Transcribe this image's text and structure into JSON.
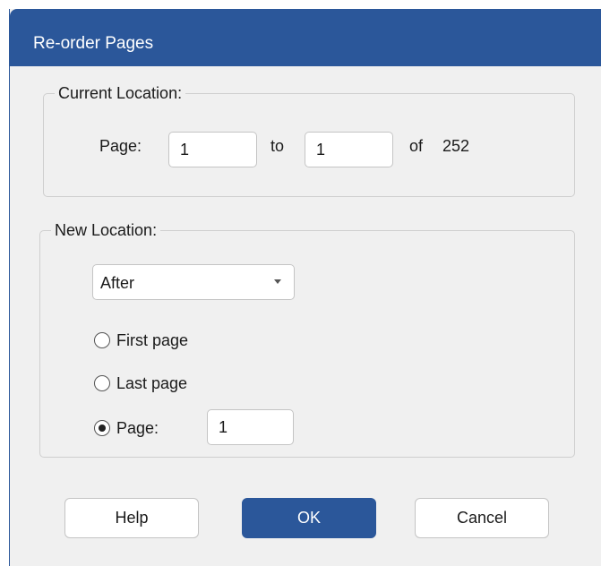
{
  "dialog": {
    "title": "Re-order Pages"
  },
  "current_location": {
    "legend": "Current Location:",
    "page_label": "Page:",
    "from_value": "1",
    "to_label": "to",
    "to_value": "1",
    "of_label": "of",
    "total_pages": "252"
  },
  "new_location": {
    "legend": "New Location:",
    "position_select": "After",
    "options": [
      {
        "label": "First page",
        "selected": false
      },
      {
        "label": "Last page",
        "selected": false
      },
      {
        "label": "Page:",
        "selected": true
      }
    ],
    "page_value": "1"
  },
  "buttons": {
    "help": "Help",
    "ok": "OK",
    "cancel": "Cancel"
  },
  "colors": {
    "accent": "#2b579a",
    "dialog_bg": "#f0f0f0"
  }
}
